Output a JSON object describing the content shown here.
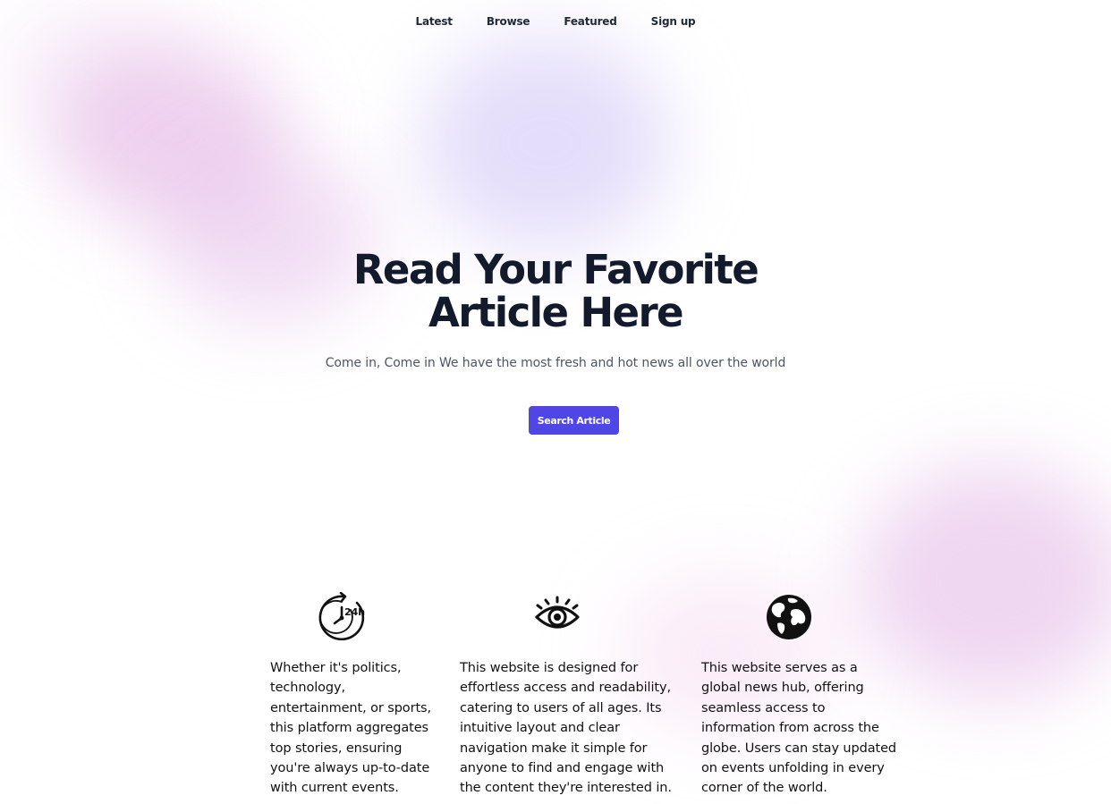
{
  "nav": {
    "items": [
      {
        "label": "Latest"
      },
      {
        "label": "Browse"
      },
      {
        "label": "Featured"
      },
      {
        "label": "Sign up"
      }
    ]
  },
  "hero": {
    "title_line1": "Read Your Favorite",
    "title_line2": "Article Here",
    "subtitle": "Come in, Come in We have the most fresh and hot news all over the world",
    "button_label": "Search Article"
  },
  "features": [
    {
      "icon": "clock-24h-icon",
      "text": "Whether it's politics, technology, entertainment, or sports, this platform aggregates top stories, ensuring you're always up-to-date with current events."
    },
    {
      "icon": "eye-icon",
      "text": "This website is designed for effortless access and readability, catering to users of all ages. Its intuitive layout and clear navigation make it simple for anyone to find and engage with the content they're interested in."
    },
    {
      "icon": "globe-icon",
      "text": "This website serves as a global news hub, offering seamless access to information from across the globe. Users can stay updated on events unfolding in every corner of the world."
    }
  ],
  "colors": {
    "accent": "#4f46e5",
    "title": "#131a2c",
    "subtitle": "#4b5563"
  }
}
